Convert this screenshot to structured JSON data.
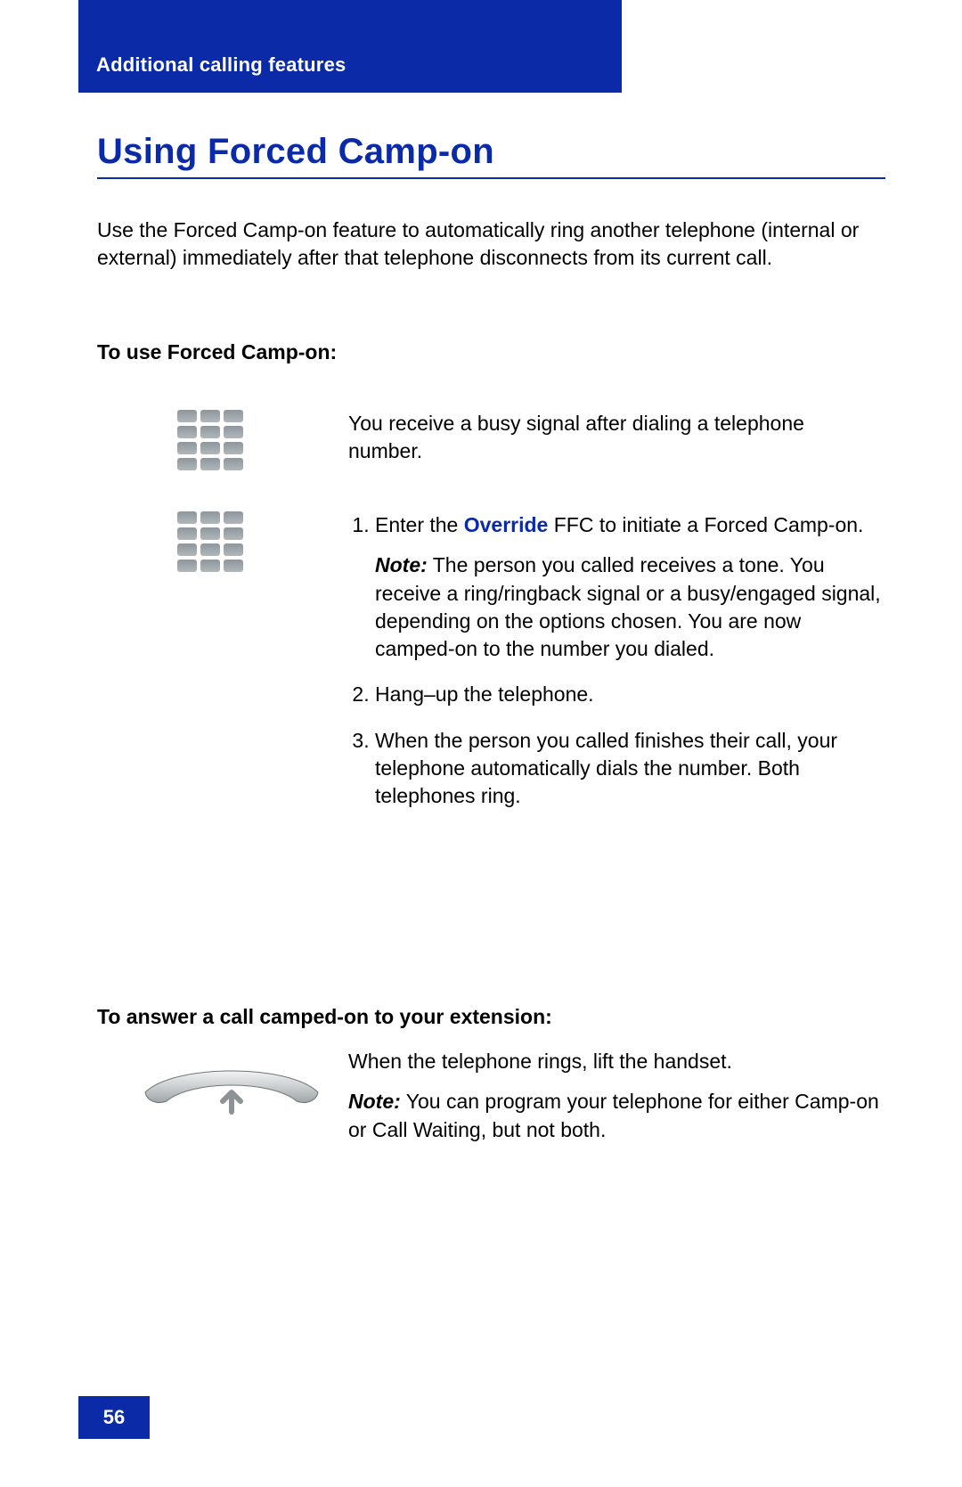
{
  "header": {
    "section": "Additional calling features"
  },
  "title": "Using Forced Camp-on",
  "intro": "Use the Forced Camp-on feature to automatically ring another telephone (internal or external) immediately after that telephone disconnects from its current call.",
  "subhead1": "To use Forced Camp-on:",
  "busy_signal": "You receive a busy signal after dialing a telephone number.",
  "step1_prefix": "Enter the ",
  "step1_override": "Override",
  "step1_suffix": " FFC to initiate a Forced Camp-on.",
  "note_label": "Note:",
  "step1_note": " The person you called receives a tone. You receive a ring/ringback signal or a busy/engaged signal, depending on the options chosen. You are now camped-on to the number you dialed.",
  "step2": "Hang–up the telephone.",
  "step3": "When the person you called finishes their call, your telephone automatically dials the number. Both telephones ring.",
  "subhead2": "To answer a call camped-on to your extension:",
  "answer_text": "When the telephone rings, lift the handset.",
  "answer_note": " You can program your telephone for either Camp-on or Call Waiting, but not both.",
  "page_number": "56"
}
